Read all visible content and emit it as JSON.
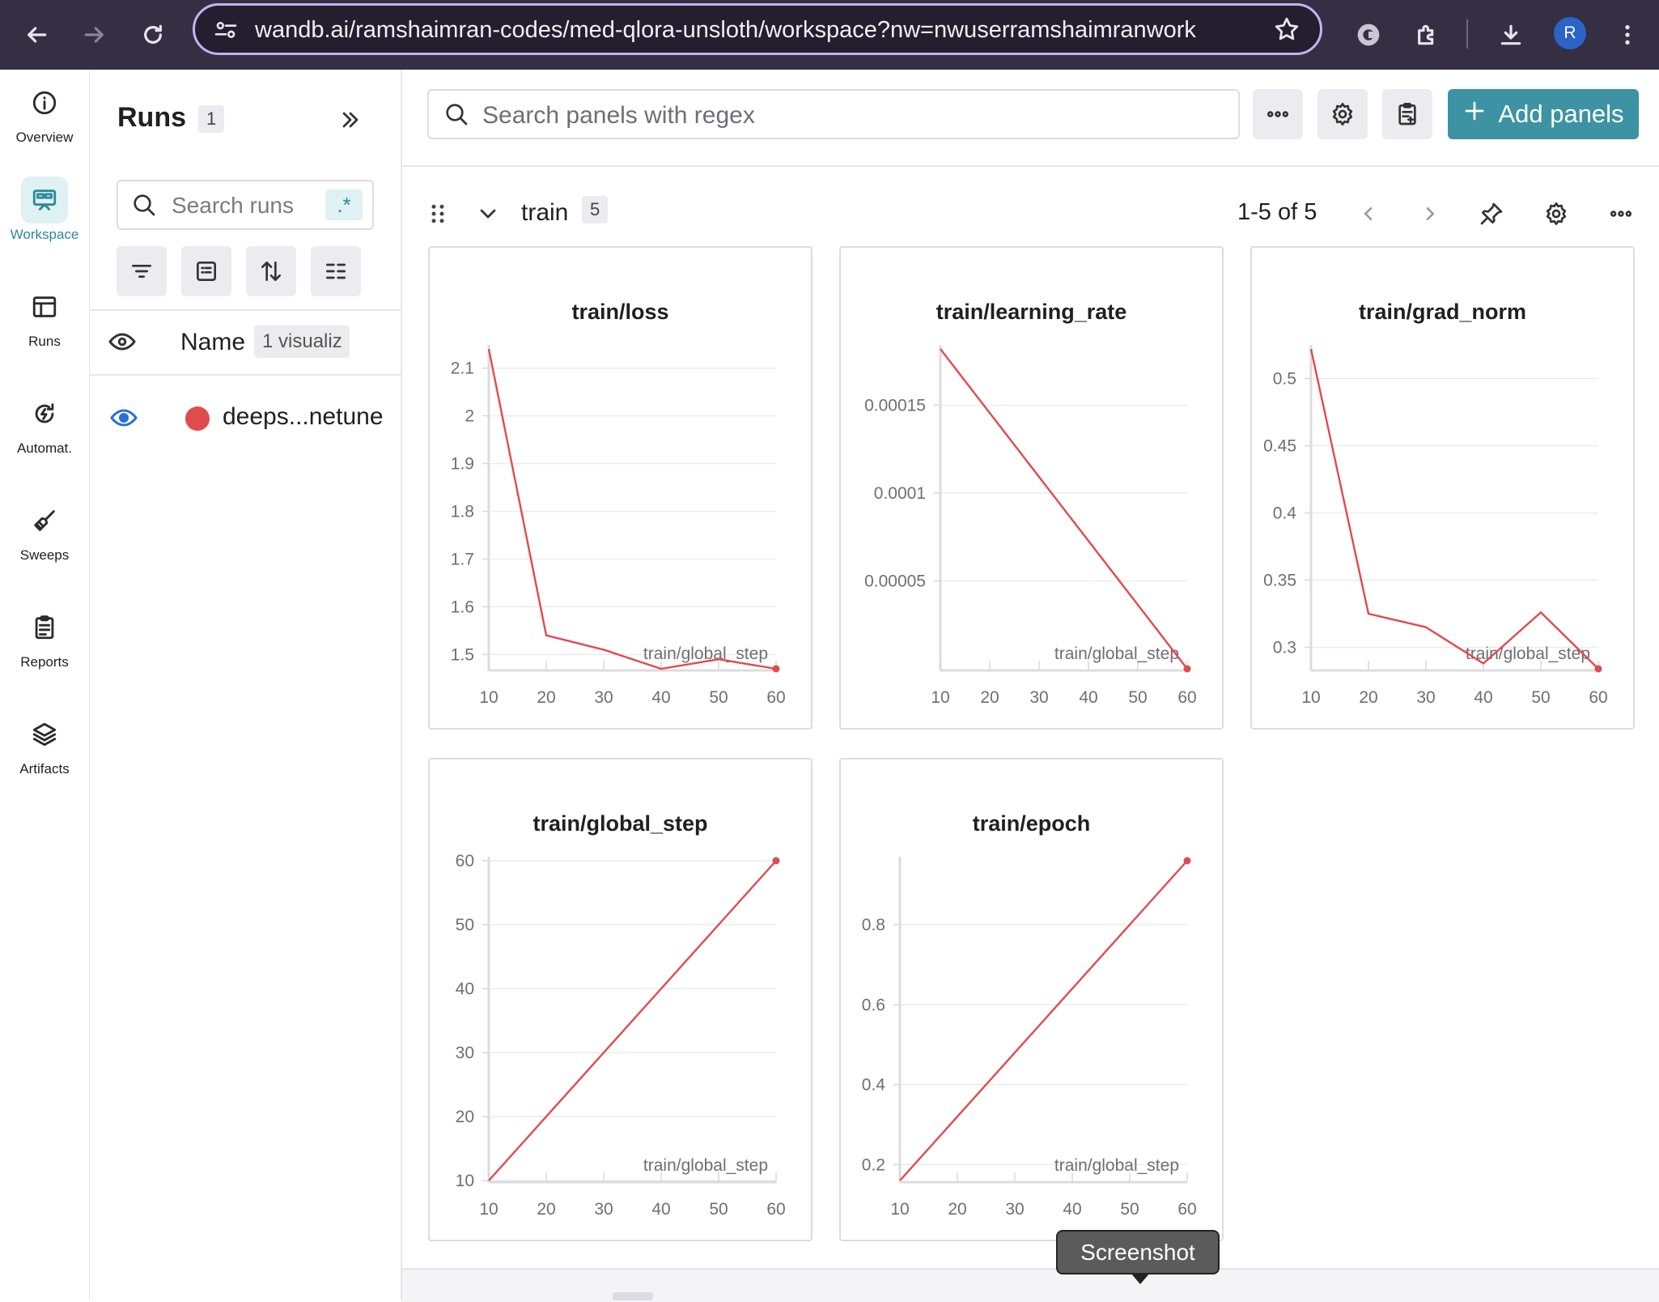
{
  "browser": {
    "url": "wandb.ai/ramshaimran-codes/med-qlora-unsloth/workspace?nw=nwuserramshaimranwork",
    "profile_initial": "R"
  },
  "nav": {
    "items": [
      {
        "label": "Overview",
        "icon": "info-icon",
        "active": false
      },
      {
        "label": "Workspace",
        "icon": "workspace-icon",
        "active": true
      },
      {
        "label": "Runs",
        "icon": "runs-table-icon",
        "active": false
      },
      {
        "label": "Automat.",
        "icon": "automation-icon",
        "active": false
      },
      {
        "label": "Sweeps",
        "icon": "sweeps-broom-icon",
        "active": false
      },
      {
        "label": "Reports",
        "icon": "clipboard-icon",
        "active": false
      },
      {
        "label": "Artifacts",
        "icon": "layers-icon",
        "active": false
      }
    ]
  },
  "runs_panel": {
    "title": "Runs",
    "count": "1",
    "search_placeholder": "Search runs",
    "regex_label": ".*",
    "name_header": "Name",
    "visualize_badge": "1 visualiz",
    "run": {
      "name": "deeps...netune",
      "color": "#e04b4e"
    }
  },
  "workspace": {
    "search_placeholder": "Search panels with regex",
    "add_panels_label": "Add panels",
    "section": {
      "name": "train",
      "count": "5",
      "pager": "1-5 of 5"
    }
  },
  "panels": [
    {
      "title": "train/loss",
      "chart_data": {
        "type": "line",
        "color": "#e04b4e",
        "xlabel": "train/global_step",
        "x": [
          10,
          20,
          30,
          40,
          50,
          60
        ],
        "y": [
          2.14,
          1.54,
          1.51,
          1.47,
          1.49,
          1.47
        ],
        "xlim": [
          10,
          60
        ],
        "ylim": [
          1.47,
          2.14
        ],
        "xticks": [
          "10",
          "20",
          "30",
          "40",
          "50",
          "60"
        ],
        "yticks": [
          {
            "v": 1.5,
            "t": "1.5"
          },
          {
            "v": 1.6,
            "t": "1.6"
          },
          {
            "v": 1.7,
            "t": "1.7"
          },
          {
            "v": 1.8,
            "t": "1.8"
          },
          {
            "v": 1.9,
            "t": "1.9"
          },
          {
            "v": 2.0,
            "t": "2"
          },
          {
            "v": 2.1,
            "t": "2.1"
          }
        ]
      }
    },
    {
      "title": "train/learning_rate",
      "chart_data": {
        "type": "line",
        "color": "#e04b4e",
        "xlabel": "train/global_step",
        "x": [
          10,
          60
        ],
        "y": [
          0.000182,
          0.0
        ],
        "xlim": [
          10,
          60
        ],
        "ylim": [
          0.0,
          0.000182
        ],
        "xticks": [
          "10",
          "20",
          "30",
          "40",
          "50",
          "60"
        ],
        "yticks": [
          {
            "v": 5e-05,
            "t": "0.00005"
          },
          {
            "v": 0.0001,
            "t": "0.0001"
          },
          {
            "v": 0.00015,
            "t": "0.00015"
          }
        ]
      }
    },
    {
      "title": "train/grad_norm",
      "chart_data": {
        "type": "line",
        "color": "#e04b4e",
        "xlabel": "train/global_step",
        "x": [
          10,
          20,
          30,
          40,
          50,
          60
        ],
        "y": [
          0.522,
          0.325,
          0.315,
          0.288,
          0.326,
          0.284
        ],
        "xlim": [
          10,
          60
        ],
        "ylim": [
          0.284,
          0.522
        ],
        "xticks": [
          "10",
          "20",
          "30",
          "40",
          "50",
          "60"
        ],
        "yticks": [
          {
            "v": 0.3,
            "t": "0.3"
          },
          {
            "v": 0.35,
            "t": "0.35"
          },
          {
            "v": 0.4,
            "t": "0.4"
          },
          {
            "v": 0.45,
            "t": "0.45"
          },
          {
            "v": 0.5,
            "t": "0.5"
          }
        ]
      }
    },
    {
      "title": "train/global_step",
      "chart_data": {
        "type": "line",
        "color": "#e04b4e",
        "xlabel": "train/global_step",
        "x": [
          10,
          60
        ],
        "y": [
          10,
          60
        ],
        "xlim": [
          10,
          60
        ],
        "ylim": [
          10,
          60
        ],
        "xticks": [
          "10",
          "20",
          "30",
          "40",
          "50",
          "60"
        ],
        "yticks": [
          {
            "v": 10,
            "t": "10"
          },
          {
            "v": 20,
            "t": "20"
          },
          {
            "v": 30,
            "t": "30"
          },
          {
            "v": 40,
            "t": "40"
          },
          {
            "v": 50,
            "t": "50"
          },
          {
            "v": 60,
            "t": "60"
          }
        ]
      }
    },
    {
      "title": "train/epoch",
      "chart_data": {
        "type": "line",
        "color": "#e04b4e",
        "xlabel": "train/global_step",
        "x": [
          10,
          60
        ],
        "y": [
          0.16,
          0.96
        ],
        "xlim": [
          10,
          60
        ],
        "ylim": [
          0.16,
          0.96
        ],
        "xticks": [
          "10",
          "20",
          "30",
          "40",
          "50",
          "60"
        ],
        "yticks": [
          {
            "v": 0.2,
            "t": "0.2"
          },
          {
            "v": 0.4,
            "t": "0.4"
          },
          {
            "v": 0.6,
            "t": "0.6"
          },
          {
            "v": 0.8,
            "t": "0.8"
          }
        ]
      }
    }
  ],
  "tooltip": {
    "text": "Screenshot"
  }
}
